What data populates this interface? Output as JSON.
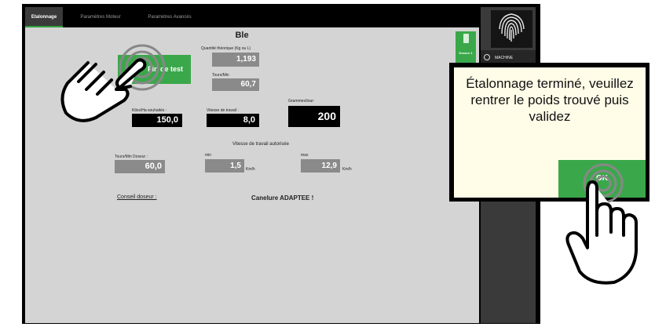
{
  "tabs": [
    {
      "label": "Etalonnage",
      "active": true
    },
    {
      "label": "Paramètres Moteur",
      "active": false
    },
    {
      "label": "Paramètres Avancés",
      "active": false
    }
  ],
  "product_title": "Ble",
  "theoretical_qty": {
    "label": "Quantité théorique (Kg ou L)",
    "value": "1,193"
  },
  "rpm": {
    "label": "Tours/Min",
    "value": "60,7"
  },
  "test_button": {
    "label": "Fin de test"
  },
  "kg_ha": {
    "label": "Kilos/Ha souhaités :",
    "value": "150,0"
  },
  "work_speed": {
    "label": "Vitesse de travail :",
    "value": "8,0"
  },
  "grams_per_turn": {
    "label": "Grammes/tour:",
    "value": "200"
  },
  "allowed_speed": {
    "title": "Vitesse de travail autorisée",
    "min_label": "min",
    "min_value": "1,5",
    "min_unit": "Km/h",
    "max_label": "max",
    "max_value": "12,9",
    "max_unit": "Km/h"
  },
  "doseur_rpm": {
    "label": "Tours/Min Doseur :",
    "value": "60,0"
  },
  "advice": {
    "link": "Conseil doseur :",
    "text": "Canelure ADAPTEE !"
  },
  "side": {
    "doseur_label": "Doseur 1",
    "machine_label": "MACHINE"
  },
  "dialog": {
    "message": "Étalonnage terminé, veuillez rentrer le poids trouvé puis validez",
    "ok_label": "OK"
  },
  "colors": {
    "accent_green": "#3aa84a",
    "panel_dark": "#3a3a3a",
    "screen_bg": "#d4d4d4",
    "dialog_bg": "#fffde8"
  }
}
